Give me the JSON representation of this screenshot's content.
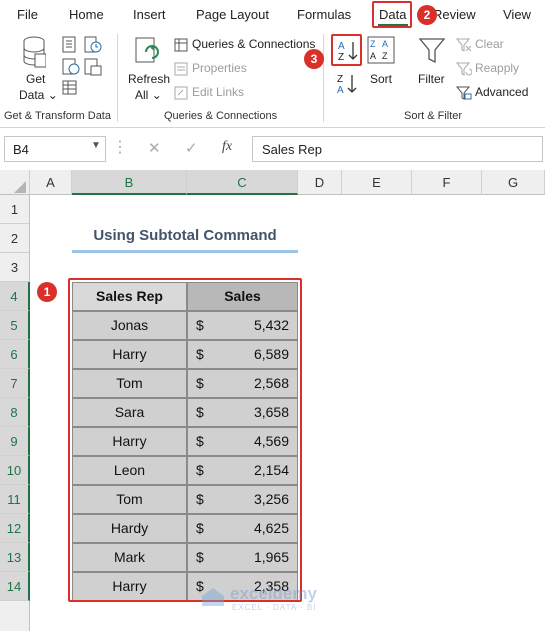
{
  "tabs": [
    "File",
    "Home",
    "Insert",
    "Page Layout",
    "Formulas",
    "Data",
    "Review",
    "View"
  ],
  "ribbon": {
    "get_data": [
      "Get",
      "Data"
    ],
    "get_transform_label": "Get & Transform Data",
    "refresh": [
      "Refresh",
      "All"
    ],
    "queries_connections": "Queries & Connections",
    "properties": "Properties",
    "edit_links": "Edit Links",
    "queries_label": "Queries & Connections",
    "sort_az": [
      "A",
      "Z"
    ],
    "sort_za": [
      "Z",
      "A"
    ],
    "sort": "Sort",
    "filter": "Filter",
    "clear": "Clear",
    "reapply": "Reapply",
    "advanced": "Advanced",
    "sort_filter_label": "Sort & Filter"
  },
  "formula_bar": {
    "name_box": "B4",
    "content": "Sales Rep"
  },
  "columns": [
    "A",
    "B",
    "C",
    "D",
    "E",
    "F",
    "G"
  ],
  "rows": [
    "1",
    "2",
    "3",
    "4",
    "5",
    "6",
    "7",
    "8",
    "9",
    "10",
    "11",
    "12",
    "13",
    "14"
  ],
  "sheet": {
    "title": "Using Subtotal Command",
    "headers": [
      "Sales Rep",
      "Sales"
    ],
    "currency": "$",
    "data": [
      [
        "Jonas",
        "5,432"
      ],
      [
        "Harry",
        "6,589"
      ],
      [
        "Tom",
        "2,568"
      ],
      [
        "Sara",
        "3,658"
      ],
      [
        "Harry",
        "4,569"
      ],
      [
        "Leon",
        "2,154"
      ],
      [
        "Tom",
        "3,256"
      ],
      [
        "Hardy",
        "4,625"
      ],
      [
        "Mark",
        "1,965"
      ],
      [
        "Harry",
        "2,358"
      ]
    ]
  },
  "badges": [
    "1",
    "2",
    "3"
  ],
  "watermark": {
    "name": "exceldemy",
    "tagline": "EXCEL · DATA · BI"
  },
  "colors": {
    "red": "#d9302a",
    "excel_green": "#217346",
    "table_fill": "#d0d0d0",
    "title_underline": "#9dc3e6"
  }
}
